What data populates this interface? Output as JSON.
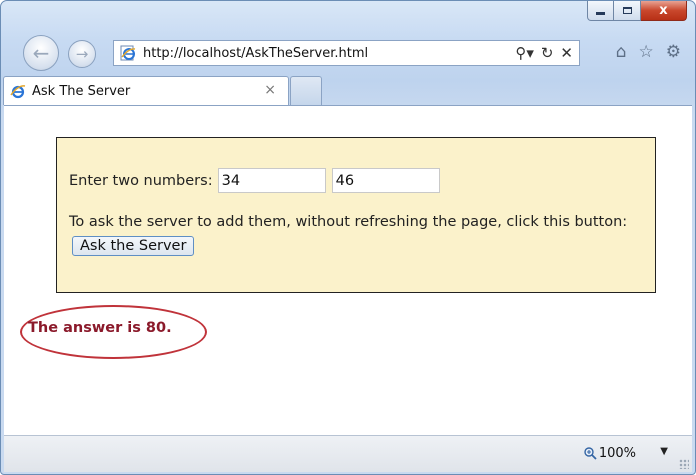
{
  "browser": {
    "address": {
      "url": "http://localhost/AskTheServer.html"
    },
    "tab": {
      "title": "Ask The Server",
      "close_glyph": "×"
    },
    "window_controls": {
      "close_glyph": "x"
    },
    "icons": [
      "back-icon",
      "forward-icon",
      "ie-page-icon",
      "search-dropdown-icon",
      "refresh-icon",
      "stop-icon",
      "home-icon",
      "favorites-star-icon",
      "settings-gear-icon",
      "zoom-icon"
    ],
    "status": {
      "zoom_level": "100%"
    }
  },
  "page": {
    "prompt_label": "Enter two numbers:",
    "number1": "34",
    "number2": "46",
    "instruction": "To ask the server to add them, without refreshing the page, click this button:",
    "button_label": "Ask the Server",
    "answer_text": "The answer is 80.",
    "colors": {
      "panel_bg": "#fbf2cb",
      "answer": "#8b1a2b",
      "highlight_ellipse": "#c0333a"
    }
  }
}
